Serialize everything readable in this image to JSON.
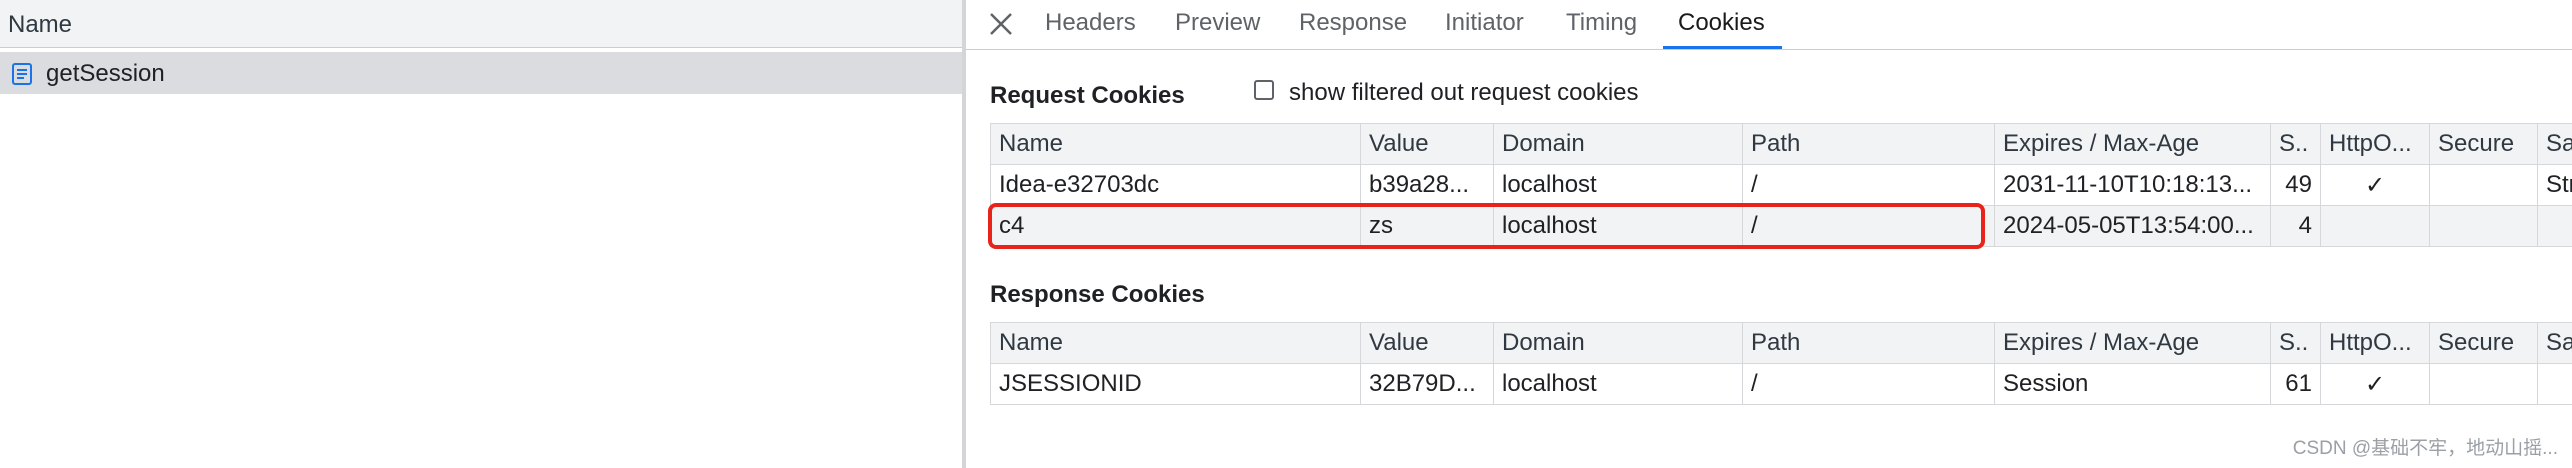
{
  "left_pane": {
    "header": "Name",
    "requests": [
      {
        "name": "getSession",
        "icon": "document-icon"
      }
    ]
  },
  "tabs": [
    "Headers",
    "Preview",
    "Response",
    "Initiator",
    "Timing",
    "Cookies"
  ],
  "active_tab": "Cookies",
  "request_cookies": {
    "title": "Request Cookies",
    "checkbox_label": "show filtered out request cookies",
    "checkbox_checked": false,
    "columns": [
      "Name",
      "Value",
      "Domain",
      "Path",
      "Expires / Max-Age",
      "S..",
      "HttpO...",
      "Secure",
      "Sa"
    ],
    "rows": [
      [
        "Idea-e32703dc",
        "b39a28...",
        "localhost",
        "/",
        "2031-11-10T10:18:13...",
        "49",
        "✓",
        "",
        "Str"
      ],
      [
        "c4",
        "zs",
        "localhost",
        "/",
        "2024-05-05T13:54:00...",
        "4",
        "",
        "",
        ""
      ]
    ]
  },
  "response_cookies": {
    "title": "Response Cookies",
    "columns": [
      "Name",
      "Value",
      "Domain",
      "Path",
      "Expires / Max-Age",
      "S..",
      "HttpO...",
      "Secure",
      "Sa"
    ],
    "rows": [
      [
        "JSESSIONID",
        "32B79D...",
        "localhost",
        "/",
        "Session",
        "61",
        "✓",
        "",
        ""
      ]
    ]
  },
  "watermark": "CSDN @基础不牢，地动山摇...",
  "colors": {
    "accent": "#1a73e8",
    "highlight": "#e8241a",
    "header_bg": "#f1f3f4",
    "selected_row": "#dadce0"
  }
}
